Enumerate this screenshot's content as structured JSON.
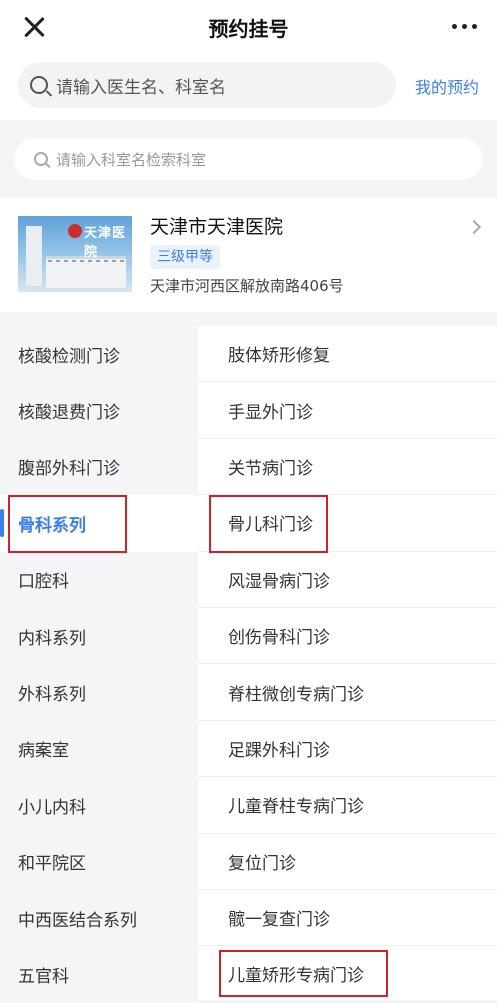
{
  "header": {
    "title": "预约挂号"
  },
  "search": {
    "placeholder": "请输入医生名、科室名",
    "my_appointments": "我的预约"
  },
  "dept_search": {
    "placeholder": "请输入科室名检索科室"
  },
  "hospital": {
    "name": "天津市天津医院",
    "level": "三级甲等",
    "address": "天津市河西区解放南路406号",
    "logo_text": "天津医院"
  },
  "departments": [
    {
      "label": "核酸检测门诊"
    },
    {
      "label": "核酸退费门诊"
    },
    {
      "label": "腹部外科门诊"
    },
    {
      "label": "骨科系列",
      "active": true
    },
    {
      "label": "口腔科"
    },
    {
      "label": "内科系列"
    },
    {
      "label": "外科系列"
    },
    {
      "label": "病案室"
    },
    {
      "label": "小儿内科"
    },
    {
      "label": "和平院区"
    },
    {
      "label": "中西医结合系列"
    },
    {
      "label": "五官科"
    }
  ],
  "clinics": [
    {
      "label": "肢体矫形修复"
    },
    {
      "label": "手显外门诊"
    },
    {
      "label": "关节病门诊"
    },
    {
      "label": "骨儿科门诊"
    },
    {
      "label": "风湿骨病门诊"
    },
    {
      "label": "创伤骨科门诊"
    },
    {
      "label": "脊柱微创专病门诊"
    },
    {
      "label": "足踝外科门诊"
    },
    {
      "label": "儿童脊柱专病门诊"
    },
    {
      "label": "复位门诊"
    },
    {
      "label": "髋一复查门诊"
    },
    {
      "label": "儿童矫形专病门诊"
    }
  ],
  "colors": {
    "accent": "#3b7ef0",
    "highlight_box": "#d0212b"
  }
}
